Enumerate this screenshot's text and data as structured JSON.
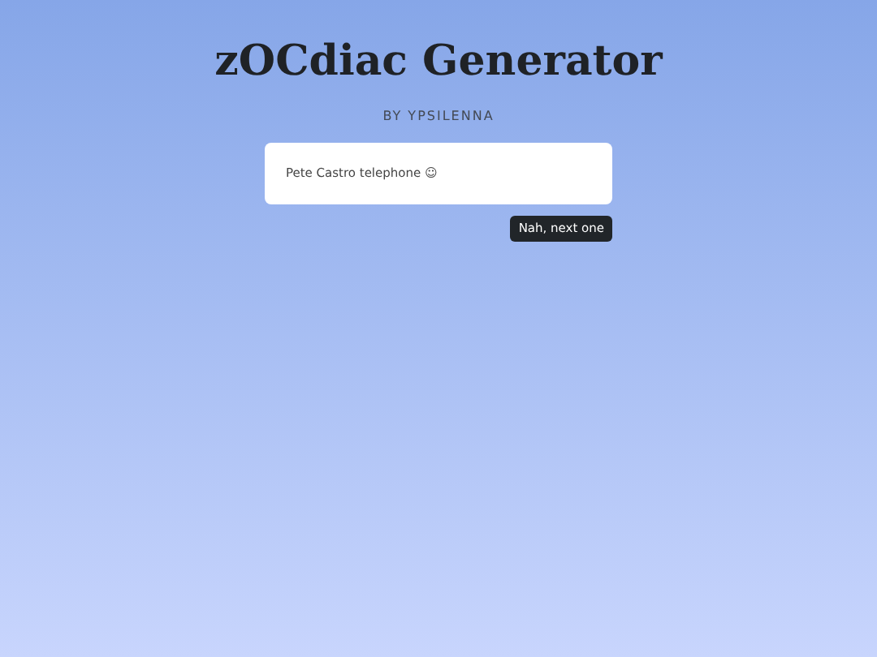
{
  "title": "zOCdiac Generator",
  "byline": "BY YPSILENNA",
  "result": "Pete Castro telephone ☺",
  "buttons": [
    "Nah, next one"
  ]
}
